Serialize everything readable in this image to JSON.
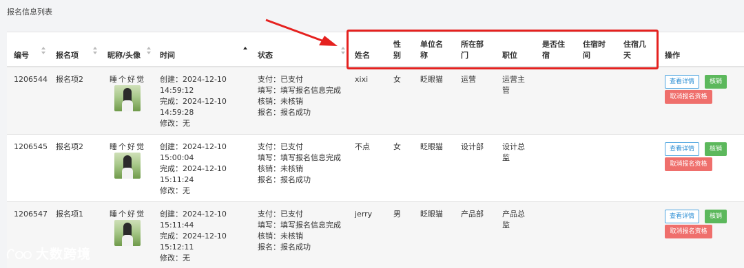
{
  "panel": {
    "title": "报名信息列表"
  },
  "table": {
    "headers": {
      "id": "编号",
      "item": "报名项",
      "nick_avatar": "昵称/头像",
      "time": "时间",
      "status": "状态",
      "name": "姓名",
      "gender": "性别",
      "company": "单位名称",
      "dept": "所在部门",
      "position": "职位",
      "lodging": "是否住宿",
      "lodging_time": "住宿时间",
      "lodging_days": "住宿几天",
      "actions": "操作"
    },
    "rows": [
      {
        "id": "1206544",
        "item": "报名项2",
        "nickname": "睡个好觉",
        "time": [
          "创建：2024-12-10",
          "14:59:12",
          "完成：2024-12-10",
          "14:59:28",
          "修改：无"
        ],
        "status": [
          "支付：已支付",
          "填写：填写报名信息完成",
          "核销：未核销",
          "报名：报名成功"
        ],
        "name": "xixi",
        "gender": "女",
        "company": "眨眼猫",
        "dept": "运营",
        "position": "运营主管",
        "lodging": "",
        "lodging_time": "",
        "lodging_days": ""
      },
      {
        "id": "1206545",
        "item": "报名项2",
        "nickname": "睡个好觉",
        "time": [
          "创建：2024-12-10",
          "15:00:04",
          "完成：2024-12-10",
          "15:11:24",
          "修改：无"
        ],
        "status": [
          "支付：已支付",
          "填写：填写报名信息完成",
          "核销：未核销",
          "报名：报名成功"
        ],
        "name": "不点",
        "gender": "女",
        "company": "眨眼猫",
        "dept": "设计部",
        "position": "设计总监",
        "lodging": "",
        "lodging_time": "",
        "lodging_days": ""
      },
      {
        "id": "1206547",
        "item": "报名项1",
        "nickname": "睡个好觉",
        "time": [
          "创建：2024-12-10",
          "15:11:44",
          "完成：2024-12-10",
          "15:12:11",
          "修改：无"
        ],
        "status": [
          "支付：已支付",
          "填写：填写报名信息完成",
          "核销：未核销",
          "报名：报名成功"
        ],
        "name": "jerry",
        "gender": "男",
        "company": "眨眼猫",
        "dept": "产品部",
        "position": "产品总监",
        "lodging": "",
        "lodging_time": "",
        "lodging_days": ""
      }
    ],
    "actions": {
      "view": "查看详情",
      "verify": "核销",
      "cancel": "取消报名资格"
    }
  },
  "watermark": {
    "text": "大数跨境"
  },
  "colors": {
    "highlight": "#e5211f",
    "green": "#5cb85c",
    "red": "#ef6f6c",
    "blue": "#2d8fd5"
  }
}
